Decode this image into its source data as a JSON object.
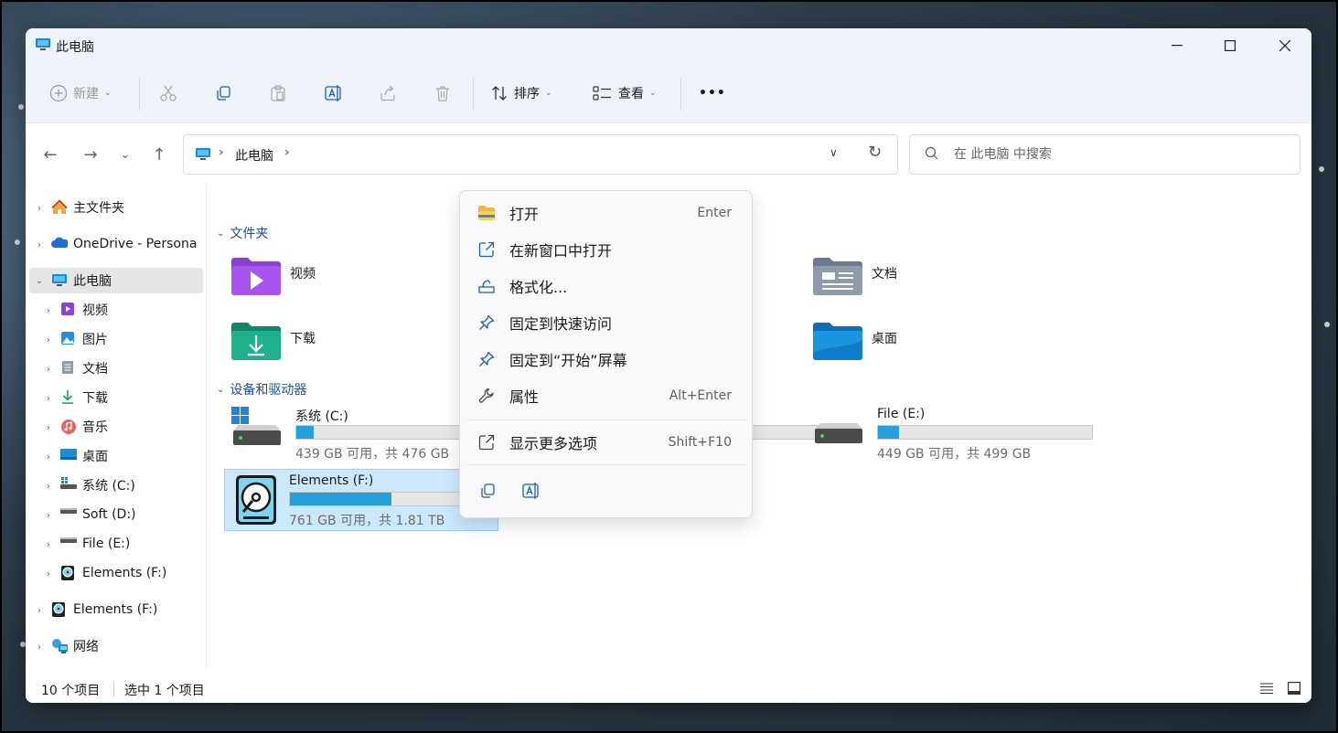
{
  "window": {
    "title": "此电脑"
  },
  "toolbar": {
    "new_label": "新建",
    "sort_label": "排序",
    "view_label": "查看",
    "more_label": "•••"
  },
  "address": {
    "crumb": "此电脑",
    "search_placeholder": "在 此电脑 中搜索"
  },
  "sidebar": {
    "items": [
      {
        "label": "主文件夹"
      },
      {
        "label": "OneDrive - Persona"
      },
      {
        "label": "此电脑"
      },
      {
        "label": "视频"
      },
      {
        "label": "图片"
      },
      {
        "label": "文档"
      },
      {
        "label": "下载"
      },
      {
        "label": "音乐"
      },
      {
        "label": "桌面"
      },
      {
        "label": "系统 (C:)"
      },
      {
        "label": "Soft (D:)"
      },
      {
        "label": "File (E:)"
      },
      {
        "label": "Elements (F:)"
      },
      {
        "label": "Elements (F:)"
      },
      {
        "label": "网络"
      }
    ]
  },
  "content": {
    "folders_header": "文件夹",
    "devices_header": "设备和驱动器",
    "folders": [
      {
        "label": "视频"
      },
      {
        "label": "文档"
      },
      {
        "label": "下载"
      },
      {
        "label": "桌面"
      }
    ],
    "drives": [
      {
        "name": "系统 (C:)",
        "size": "439 GB 可用，共 476 GB",
        "used_fraction": 0.08
      },
      {
        "name": "File (E:)",
        "size": "449 GB 可用，共 499 GB",
        "used_fraction": 0.1
      },
      {
        "name": "Elements (F:)",
        "size": "761 GB 可用，共 1.81 TB",
        "used_fraction": 0.59
      }
    ]
  },
  "status": {
    "count": "10 个项目",
    "selected": "选中 1 个项目"
  },
  "context_menu": {
    "items": [
      {
        "label": "打开",
        "shortcut": "Enter"
      },
      {
        "label": "在新窗口中打开",
        "shortcut": ""
      },
      {
        "label": "格式化...",
        "shortcut": ""
      },
      {
        "label": "固定到快速访问",
        "shortcut": ""
      },
      {
        "label": "固定到“开始”屏幕",
        "shortcut": ""
      },
      {
        "label": "属性",
        "shortcut": "Alt+Enter"
      },
      {
        "label": "显示更多选项",
        "shortcut": "Shift+F10"
      }
    ]
  },
  "colors": {
    "accent": "#26a0da",
    "folder_header": "#1f4e9a",
    "selection": "#cce8ff"
  }
}
